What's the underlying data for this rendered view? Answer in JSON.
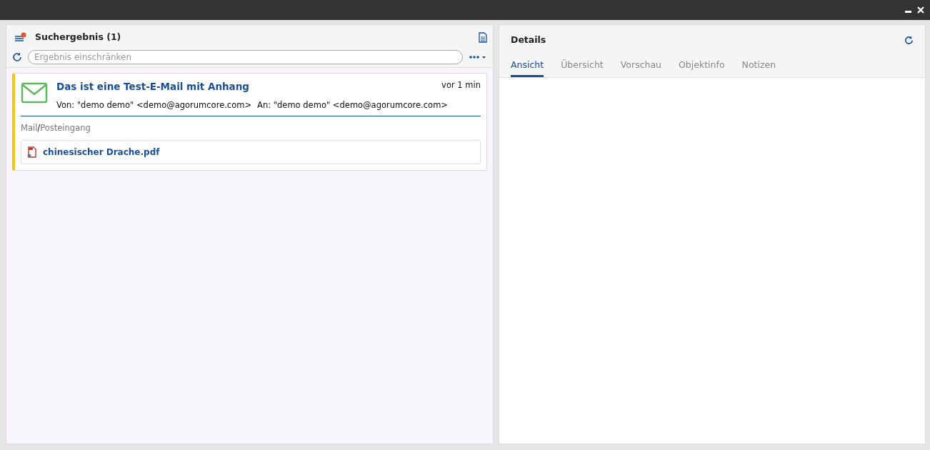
{
  "left_panel": {
    "title": "Suchergebnis (1)",
    "filter": {
      "placeholder": "Ergebnis einschränken"
    },
    "results": [
      {
        "subject": "Das ist eine Test-E-Mail mit Anhang",
        "time": "vor 1 min",
        "from": "Von: \"demo demo\" <demo@agorumcore.com>",
        "to": "An: \"demo demo\" <demo@agorumcore.com>",
        "path": [
          "Mail",
          "Posteingang"
        ],
        "path_separator": "/",
        "color": "#f5c518",
        "attachments": [
          {
            "name": "chinesischer Drache.pdf"
          }
        ]
      }
    ]
  },
  "right_panel": {
    "title": "Details",
    "tabs": [
      {
        "label": "Ansicht",
        "selected": true
      },
      {
        "label": "Übersicht",
        "selected": false
      },
      {
        "label": "Vorschau",
        "selected": false
      },
      {
        "label": "Objektinfo",
        "selected": false
      },
      {
        "label": "Notizen",
        "selected": false
      }
    ]
  }
}
